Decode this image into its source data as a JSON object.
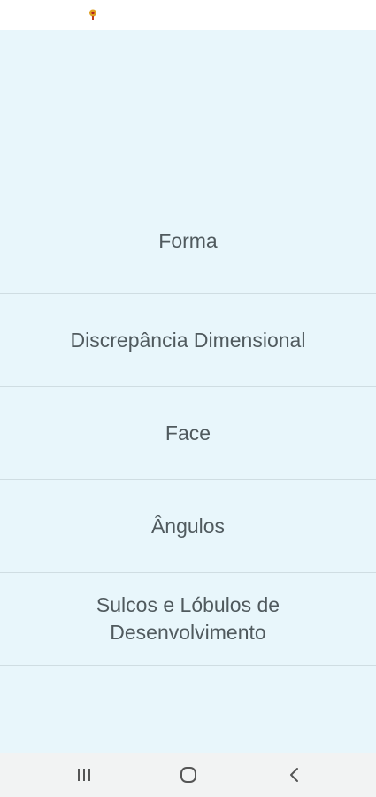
{
  "status_bar": {
    "notification_icon": "location-pin-icon",
    "icon_color": "#e0a020"
  },
  "menu": {
    "items": [
      {
        "label": "Forma"
      },
      {
        "label": "Discrepância Dimensional"
      },
      {
        "label": "Face"
      },
      {
        "label": "Ângulos"
      },
      {
        "label": "Sulcos e Lóbulos de Desenvolvimento"
      }
    ]
  },
  "nav_bar": {
    "recent_icon": "recent-apps-icon",
    "home_icon": "home-icon",
    "back_icon": "back-icon"
  },
  "colors": {
    "background": "#e8f6fb",
    "text": "#505a5e",
    "divider": "#cfdde2"
  }
}
